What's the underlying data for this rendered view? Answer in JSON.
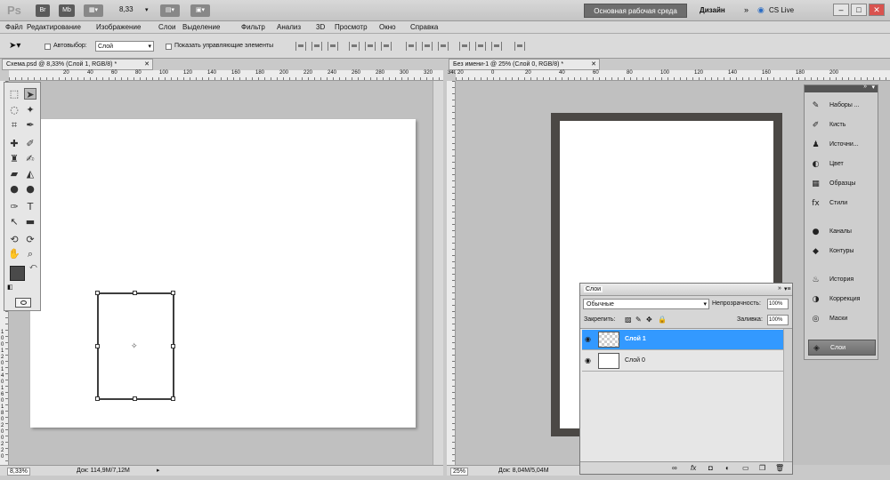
{
  "titlebar": {
    "logo": "Ps",
    "br": "Br",
    "mb": "Mb",
    "zoom": "8,33",
    "workspace": "Основная рабочая среда",
    "design": "Дизайн",
    "more": "»",
    "cslive": "CS Live",
    "min": "–",
    "max": "□",
    "close": "✕"
  },
  "menu": [
    "Файл",
    "Редактирование",
    "Изображение",
    "Слои",
    "Выделение",
    "Фильтр",
    "Анализ",
    "3D",
    "Просмотр",
    "Окно",
    "Справка"
  ],
  "options": {
    "autoselect_label": "Автовыбор:",
    "autoselect_value": "Слой",
    "show_controls": "Показать управляющие элементы"
  },
  "doc1": {
    "tab": "Схема.psd @ 8,33% (Слой 1, RGB/8) *",
    "close": "✕",
    "ruler_labels": [
      "20",
      "40",
      "60",
      "80",
      "100",
      "120",
      "140",
      "160",
      "180",
      "200",
      "220",
      "240",
      "260",
      "280",
      "300",
      "320",
      "340",
      "360"
    ],
    "ruler_v": [
      "1",
      "0",
      "0",
      "1",
      "2",
      "0",
      "1",
      "4",
      "0",
      "1",
      "6",
      "0",
      "1",
      "8",
      "0",
      "2",
      "0",
      "0",
      "2",
      "2",
      "0"
    ],
    "zoom": "8,33%",
    "status": "Док: 114,9M/7,12M"
  },
  "doc2": {
    "tab": "Без имени-1 @ 25% (Слой 0, RGB/8) *",
    "close": "✕",
    "ruler_labels": [
      "20",
      "0",
      "20",
      "40",
      "60",
      "80",
      "100",
      "120",
      "140",
      "160",
      "180",
      "200"
    ],
    "zoom": "25%",
    "status": "Док: 8,04M/5,04M"
  },
  "dock": {
    "items": [
      {
        "label": "Наборы ...",
        "icon": "brush-presets-icon",
        "glyph": "✎"
      },
      {
        "label": "Кисть",
        "icon": "brush-icon",
        "glyph": "✐"
      },
      {
        "label": "Источни...",
        "icon": "clone-source-icon",
        "glyph": "♟"
      },
      {
        "label": "Цвет",
        "icon": "color-icon",
        "glyph": "◐"
      },
      {
        "label": "Образцы",
        "icon": "swatches-icon",
        "glyph": "▦"
      },
      {
        "label": "Стили",
        "icon": "styles-icon",
        "glyph": "fx"
      },
      {
        "label": "Каналы",
        "icon": "channels-icon",
        "glyph": "●"
      },
      {
        "label": "Контуры",
        "icon": "paths-icon",
        "glyph": "◆"
      },
      {
        "label": "История",
        "icon": "history-icon",
        "glyph": "♨"
      },
      {
        "label": "Коррекция",
        "icon": "adjustments-icon",
        "glyph": "◑"
      },
      {
        "label": "Маски",
        "icon": "masks-icon",
        "glyph": "◎"
      },
      {
        "label": "Слои",
        "icon": "layers-icon",
        "glyph": "◈"
      }
    ]
  },
  "layers": {
    "title": "Слои",
    "blend": "Обычные",
    "opacity_label": "Непрозрачность:",
    "opacity": "100%",
    "lock_label": "Закрепить:",
    "fill_label": "Заливка:",
    "fill": "100%",
    "rows": [
      {
        "name": "Слой 1",
        "selected": true
      },
      {
        "name": "Слой 0",
        "selected": false
      }
    ],
    "bottom_icons": [
      "∞",
      "fx",
      "◘",
      "◐",
      "▭",
      "❐",
      "🗑"
    ]
  },
  "colors": {
    "accent": "#3399ff",
    "foreground": "#4a4a4a",
    "frame": "#4b4845"
  }
}
